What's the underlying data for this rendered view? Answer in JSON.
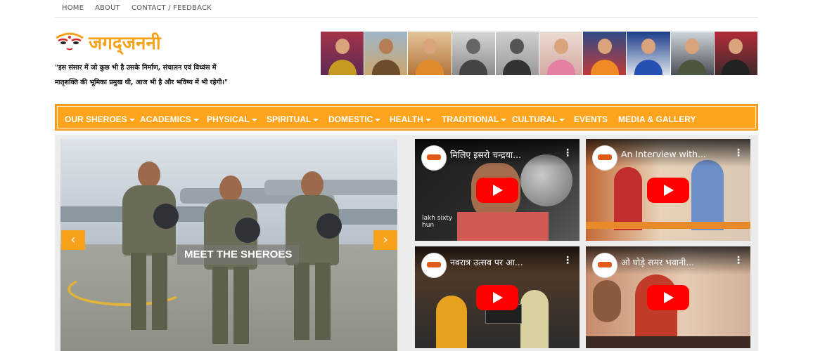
{
  "topnav": {
    "items": [
      "HOME",
      "ABOUT",
      "CONTACT / FEEDBACK"
    ]
  },
  "logo": {
    "text": "जगद्जननी"
  },
  "tagline": {
    "line1": "\"इस संसार में जो कुछ भी है उसके निर्माण, संचालन एवं विध्वंस में",
    "line2": "मातृशक्ति की भूमिका प्रमुख थी, आज भी है और भविष्य में भी रहेगी।\""
  },
  "mainnav": {
    "items": [
      {
        "label": "OUR SHEROES",
        "dropdown": true
      },
      {
        "label": "ACADEMICS",
        "dropdown": true
      },
      {
        "label": "PHYSICAL",
        "dropdown": true
      },
      {
        "label": "SPIRITUAL",
        "dropdown": true
      },
      {
        "label": "DOMESTIC",
        "dropdown": true
      },
      {
        "label": "HEALTH",
        "dropdown": true
      },
      {
        "label": "TRADITIONAL",
        "dropdown": true
      },
      {
        "label": "CULTURAL",
        "dropdown": true
      },
      {
        "label": "EVENTS",
        "dropdown": false
      },
      {
        "label": "MEDIA & GALLERY",
        "dropdown": false
      }
    ]
  },
  "slider": {
    "caption": "MEET THE SHEROES",
    "prev_icon": "chevron-left-icon",
    "next_icon": "chevron-right-icon"
  },
  "videos": [
    {
      "title": "मिलिए इसरो चन्द्रया...",
      "subtitle1": "lakh sixty",
      "subtitle2": "hun"
    },
    {
      "title": "An Interview with...",
      "subtitle1": "",
      "subtitle2": ""
    },
    {
      "title": "नवरात्र उत्सव पर आ...",
      "subtitle1": "",
      "subtitle2": ""
    },
    {
      "title": "ओ घोड़े समर भवानी...",
      "subtitle1": "",
      "subtitle2": ""
    }
  ],
  "colors": {
    "accent": "#ffa41c",
    "logo": "#f7a21b",
    "play": "#ff0000"
  }
}
